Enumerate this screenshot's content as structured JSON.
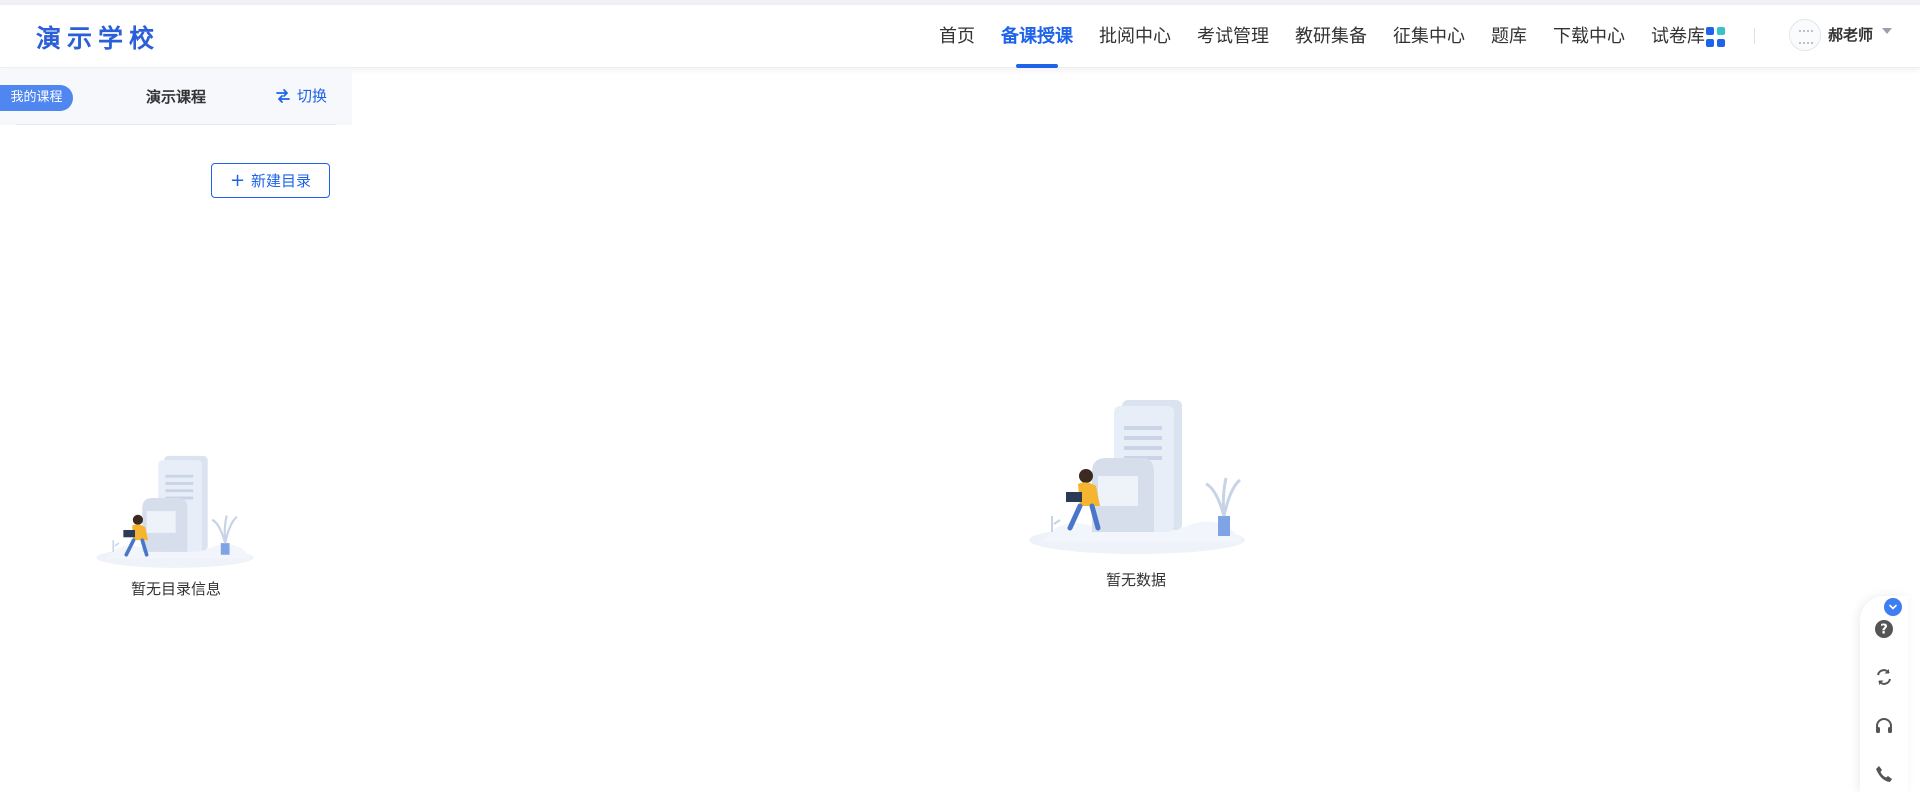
{
  "header": {
    "logo_text": "演示学校",
    "nav": [
      {
        "label": "首页",
        "active": false
      },
      {
        "label": "备课授课",
        "active": true
      },
      {
        "label": "批阅中心",
        "active": false
      },
      {
        "label": "考试管理",
        "active": false
      },
      {
        "label": "教研集备",
        "active": false
      },
      {
        "label": "征集中心",
        "active": false
      },
      {
        "label": "题库",
        "active": false
      },
      {
        "label": "下载中心",
        "active": false
      },
      {
        "label": "试卷库",
        "active": false
      }
    ],
    "apps_icon": "apps-grid-icon",
    "user_name": "郝老师"
  },
  "sidebar": {
    "my_course_tag": "我的课程",
    "course_name": "演示课程",
    "switch_label": "切换",
    "new_directory_label": "新建目录",
    "empty_text": "暂无目录信息"
  },
  "main": {
    "empty_text": "暂无数据"
  },
  "float_toolbar": {
    "icons": [
      "help-icon",
      "refresh-icon",
      "headset-icon",
      "phone-icon"
    ],
    "collapse_icon": "chevron-down-icon"
  },
  "colors": {
    "accent": "#1e63e9",
    "tag_bg": "#4f86ef"
  }
}
